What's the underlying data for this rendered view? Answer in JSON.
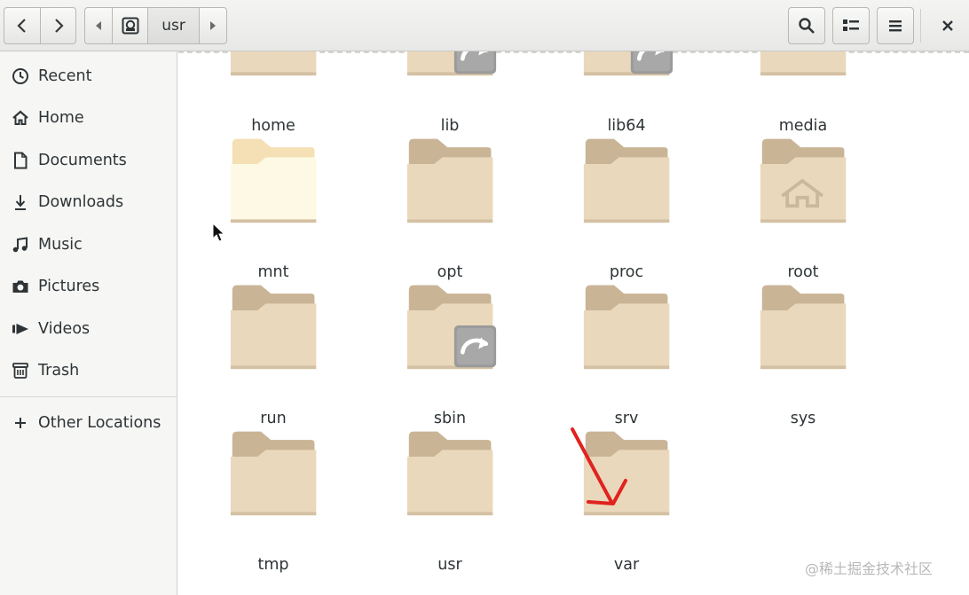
{
  "header": {
    "back_icon": "chevron-left-icon",
    "forward_icon": "chevron-right-icon",
    "path_prev_icon": "triangle-left-icon",
    "path_disk_icon": "disk-icon",
    "path_current": "usr",
    "path_next_icon": "triangle-right-icon",
    "search_icon": "search-icon",
    "view_icon": "list-view-icon",
    "menu_icon": "hamburger-menu-icon",
    "close_icon": "close-icon"
  },
  "sidebar": {
    "items": [
      {
        "label": "Recent",
        "icon": "clock-icon"
      },
      {
        "label": "Home",
        "icon": "home-icon"
      },
      {
        "label": "Documents",
        "icon": "document-icon"
      },
      {
        "label": "Downloads",
        "icon": "download-icon"
      },
      {
        "label": "Music",
        "icon": "music-icon"
      },
      {
        "label": "Pictures",
        "icon": "camera-icon"
      },
      {
        "label": "Videos",
        "icon": "video-icon"
      },
      {
        "label": "Trash",
        "icon": "trash-icon"
      }
    ],
    "other_locations": {
      "label": "Other Locations",
      "icon": "plus-icon"
    }
  },
  "files": [
    {
      "name": "home",
      "type": "folder"
    },
    {
      "name": "lib",
      "type": "symlink-folder"
    },
    {
      "name": "lib64",
      "type": "symlink-folder"
    },
    {
      "name": "media",
      "type": "folder"
    },
    {
      "name": "mnt",
      "type": "folder-selected"
    },
    {
      "name": "opt",
      "type": "folder"
    },
    {
      "name": "proc",
      "type": "folder"
    },
    {
      "name": "root",
      "type": "home-folder"
    },
    {
      "name": "run",
      "type": "folder"
    },
    {
      "name": "sbin",
      "type": "symlink-folder"
    },
    {
      "name": "srv",
      "type": "folder"
    },
    {
      "name": "sys",
      "type": "folder"
    },
    {
      "name": "tmp",
      "type": "folder"
    },
    {
      "name": "usr",
      "type": "folder"
    },
    {
      "name": "var",
      "type": "folder"
    }
  ],
  "watermark": "@稀土掘金技术社区",
  "colors": {
    "folder_back": "#c9b496",
    "folder_front": "#ead8bc",
    "folder_selected": "#fdf9e4",
    "symlink_badge": "#9a9a9a"
  }
}
